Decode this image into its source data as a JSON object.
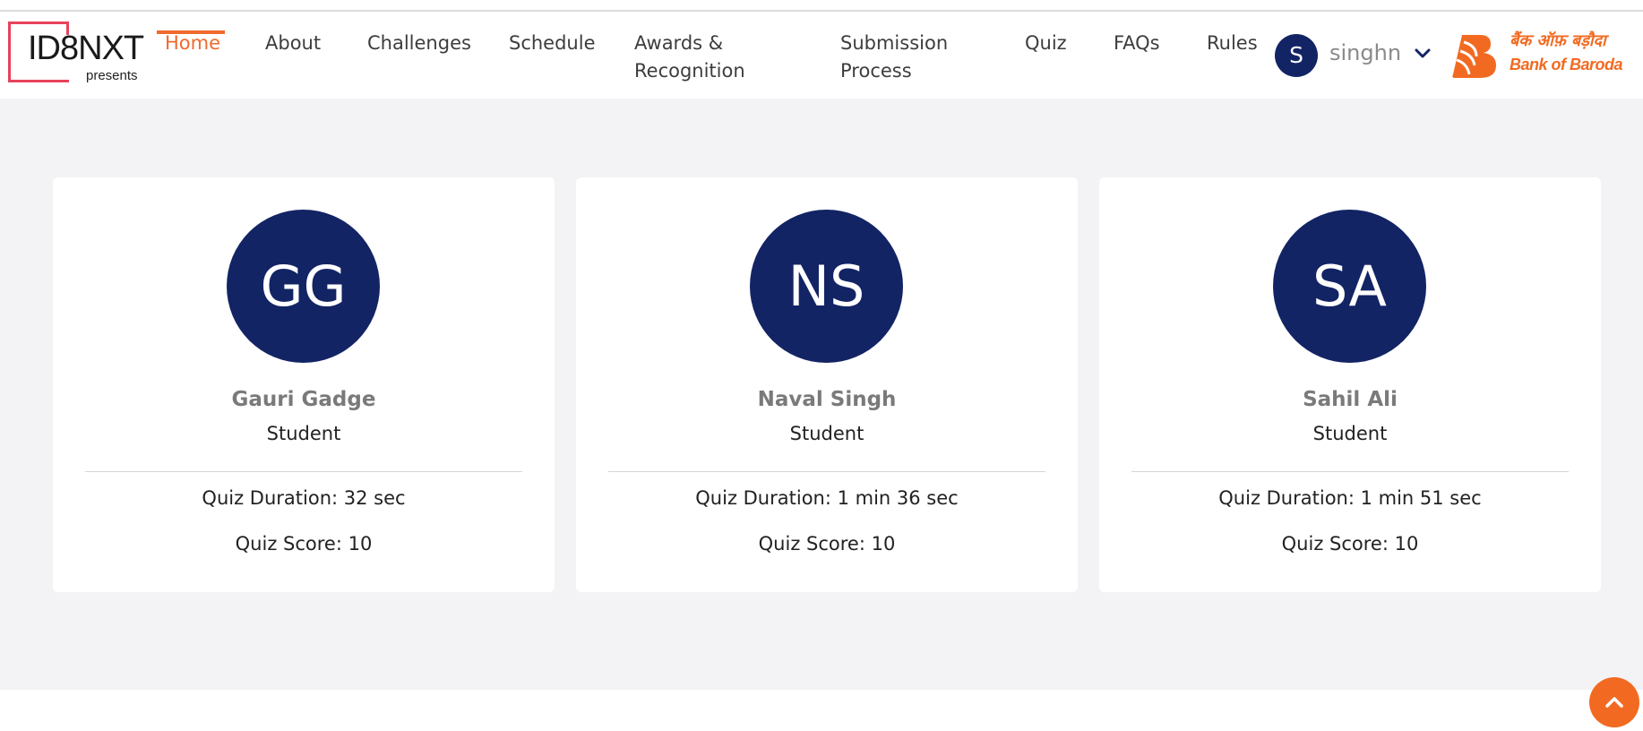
{
  "brand": {
    "logo_text": "ID8NXT",
    "logo_sub": "presents"
  },
  "nav": {
    "items": [
      {
        "label": "Home",
        "active": true
      },
      {
        "label": "About"
      },
      {
        "label": "Challenges"
      },
      {
        "label": "Schedule"
      },
      {
        "label": "Awards &\nRecognition"
      },
      {
        "label": "Submission\nProcess"
      },
      {
        "label": "Quiz"
      },
      {
        "label": "FAQs"
      },
      {
        "label": "Rules"
      }
    ]
  },
  "user": {
    "initial": "S",
    "name": "singhn",
    "menu_icon": "chevron-down-icon"
  },
  "partner": {
    "hindi": "बैंक ऑफ़ बड़ौदा",
    "english": "Bank of Baroda"
  },
  "cards": [
    {
      "initials": "GG",
      "name": "Gauri Gadge",
      "role": "Student",
      "duration": "Quiz Duration: 32 sec",
      "score": "Quiz Score: 10"
    },
    {
      "initials": "NS",
      "name": "Naval Singh",
      "role": "Student",
      "duration": "Quiz Duration: 1 min 36 sec",
      "score": "Quiz Score: 10"
    },
    {
      "initials": "SA",
      "name": "Sahil Ali",
      "role": "Student",
      "duration": "Quiz Duration: 1 min 51 sec",
      "score": "Quiz Score: 10"
    }
  ],
  "scroll_top_icon": "chevron-up-icon",
  "colors": {
    "accent": "#ef6a2e",
    "avatar": "#132465",
    "logo_red": "#e8425a",
    "background": "#f3f3f5"
  }
}
